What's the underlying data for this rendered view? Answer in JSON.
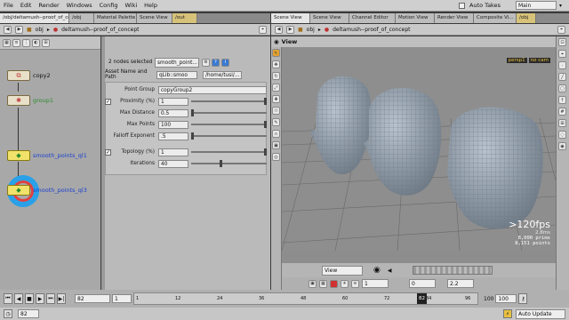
{
  "menu": [
    "File",
    "Edit",
    "Render",
    "Windows",
    "Config",
    "Wiki",
    "Help"
  ],
  "auto_takes": "Auto Takes",
  "desktop": "Main",
  "left_tabs": [
    "/obj/deltamush--proof_of_concept",
    "/obj",
    "Material Palette",
    "Scene View",
    "/out"
  ],
  "right_tabs": [
    "Scene View",
    "Scene View",
    "Channel Editor",
    "Motion View",
    "Render View",
    "Composite Vi...",
    "/obj"
  ],
  "left_path": {
    "root": "obj",
    "node": "deltamush--proof_of_concept"
  },
  "right_path": {
    "root": "obj",
    "node": "deltamush--proof_of_concept"
  },
  "nodes": [
    {
      "label": "copy2",
      "color": "#111"
    },
    {
      "label": "group1",
      "color": "#2e8b2e"
    },
    {
      "label": "smooth_points_ql1",
      "color": "#1a3fcf"
    },
    {
      "label": "smooth_points_ql3",
      "color": "#1a3fcf"
    }
  ],
  "parms": {
    "selection": "2 nodes selected",
    "node_type": "smooth_point...",
    "asset_label": "Asset Name and Path",
    "asset_name": "qLib::smoo",
    "asset_path": "/home/tusi/...",
    "point_group_label": "Point Group",
    "point_group": "copyGroup2",
    "proximity_label": "Proximity (%)",
    "proximity": "1",
    "max_distance_label": "Max Distance",
    "max_distance": "0.5",
    "max_points_label": "Max Points",
    "max_points": "100",
    "falloff_label": "Falloff Exponent",
    "falloff": ".5",
    "topology_label": "Topology (%)",
    "topology": "1",
    "iterations_label": "Iterations",
    "iterations": "40"
  },
  "viewport": {
    "title": "View",
    "camera": "persp1",
    "cam_menu": "no cam",
    "fps": ">120fps",
    "time": "2.8ms",
    "prims": "8,000  prims",
    "points": "8,151  points",
    "view_menu": "View",
    "field_a": "1",
    "field_b": "0",
    "field_c": "2.2"
  },
  "timeline": {
    "frame": "82",
    "start": "1",
    "end": "100",
    "end_field": "100",
    "marker": "82",
    "ticks": [
      "1",
      "12",
      "24",
      "36",
      "48",
      "60",
      "72",
      "84",
      "96"
    ]
  },
  "status": {
    "frame_field": "82",
    "auto_update": "Auto Update"
  },
  "colors": {
    "head": "#8c99a6",
    "grid": "#6a6a6a",
    "selected_node": "#f0e26a"
  }
}
